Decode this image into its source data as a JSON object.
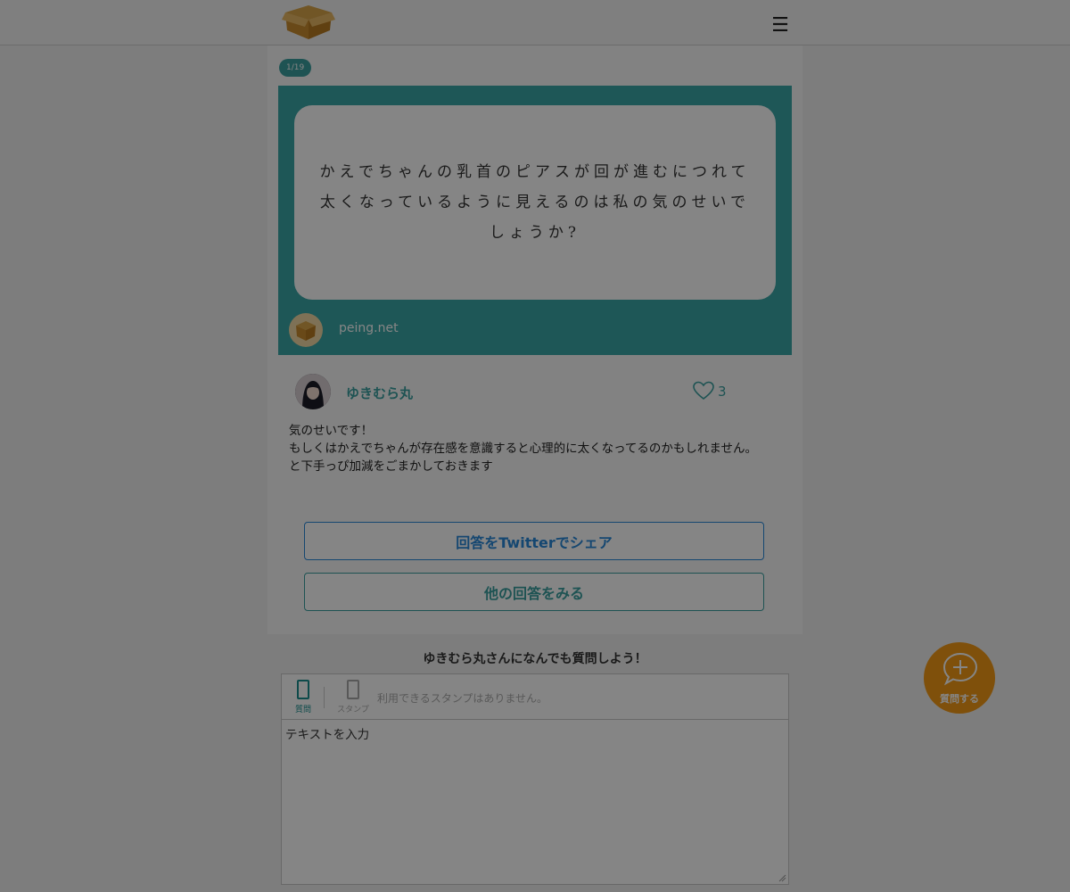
{
  "header": {
    "logo_icon": "cardboard-box-logo",
    "menu_icon": "menu-icon",
    "menu_glyph": "☰"
  },
  "pager": {
    "label": "1/19"
  },
  "card": {
    "question": "かえでちゃんの乳首のピアスが回が進むにつれて太くなっているように見えるのは私の気のせいでしょうか?",
    "source": "peing.net"
  },
  "answer": {
    "name": "ゆきむら丸",
    "likes": "3",
    "text": "気のせいです！\nもしくはかえでちゃんが存在感を意識すると心理的に太くなってるのかもしれません。\nと下手っぴ加減をごまかしておきます"
  },
  "buttons": {
    "share": "回答をTwitterでシェア",
    "more": "他の回答をみる"
  },
  "ask": {
    "heading": "ゆきむら丸さんになんでも質問しよう！",
    "tab_question": "質問",
    "tab_stamp": "スタンプ",
    "stamp_note": "利用できるスタンプはありません。",
    "placeholder": "テキストを入力"
  },
  "fab": {
    "label": "質問する"
  },
  "colors": {
    "accent": "#3aa7a7",
    "share_blue": "#2a88d8",
    "fab_orange": "#f49a16"
  }
}
